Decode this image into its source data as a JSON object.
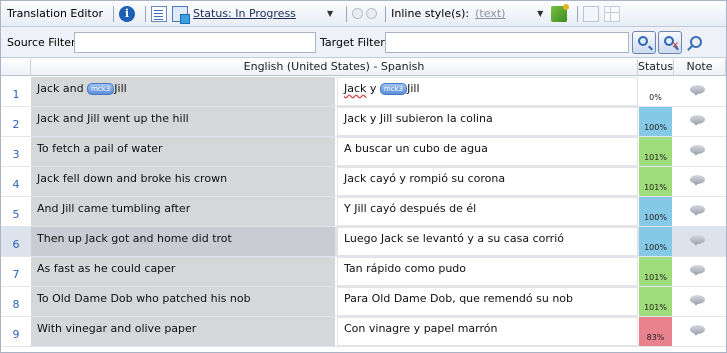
{
  "toolbar": {
    "title": "Translation Editor",
    "status_label": "Status: In Progress",
    "inline_styles_label": "Inline style(s):",
    "inline_styles_value": "(text)"
  },
  "filters": {
    "source_label": "Source Filter:",
    "target_label": "Target Filter:",
    "source_value": "",
    "target_value": ""
  },
  "grid": {
    "column_header": "English (United States) - Spanish",
    "status_header": "Status",
    "note_header": "Note",
    "tag_label": "mck3",
    "rows": [
      {
        "num": "1",
        "source_a": "Jack and ",
        "source_b": "Jill",
        "target_a": "Jack",
        "target_b": " y ",
        "target_c": "Jill",
        "status": "0%",
        "status_color": "#ffffff"
      },
      {
        "num": "2",
        "source": "Jack and Jill went up the hill",
        "target": "Jack y Jill subieron la colina",
        "status": "100%",
        "status_color": "#86c9e6"
      },
      {
        "num": "3",
        "source": "To fetch a pail of water",
        "target": "A buscar un cubo de agua",
        "status": "101%",
        "status_color": "#9fdc7c"
      },
      {
        "num": "4",
        "source": "Jack fell down and broke his crown",
        "target": "Jack cayó y rompió su corona",
        "status": "101%",
        "status_color": "#9fdc7c"
      },
      {
        "num": "5",
        "source": "And Jill came tumbling after",
        "target": "Y Jill cayó después de él",
        "status": "100%",
        "status_color": "#86c9e6"
      },
      {
        "num": "6",
        "source": "Then up Jack got and home did trot",
        "target": "Luego Jack se levantó y a su casa corrió",
        "status": "100%",
        "status_color": "#86c9e6"
      },
      {
        "num": "7",
        "source": "As fast as he could caper",
        "target": "Tan rápido como pudo",
        "status": "101%",
        "status_color": "#9fdc7c"
      },
      {
        "num": "8",
        "source": "To Old Dame Dob who patched his nob",
        "target": "Para Old Dame Dob, que remendó su nob",
        "status": "101%",
        "status_color": "#9fdc7c"
      },
      {
        "num": "9",
        "source": "With vinegar and olive paper",
        "target": "Con vinagre y papel marrón",
        "status": "83%",
        "status_color": "#e8838e"
      }
    ]
  },
  "icons": {
    "info": "info-icon",
    "note": "note-bubble-icon"
  }
}
